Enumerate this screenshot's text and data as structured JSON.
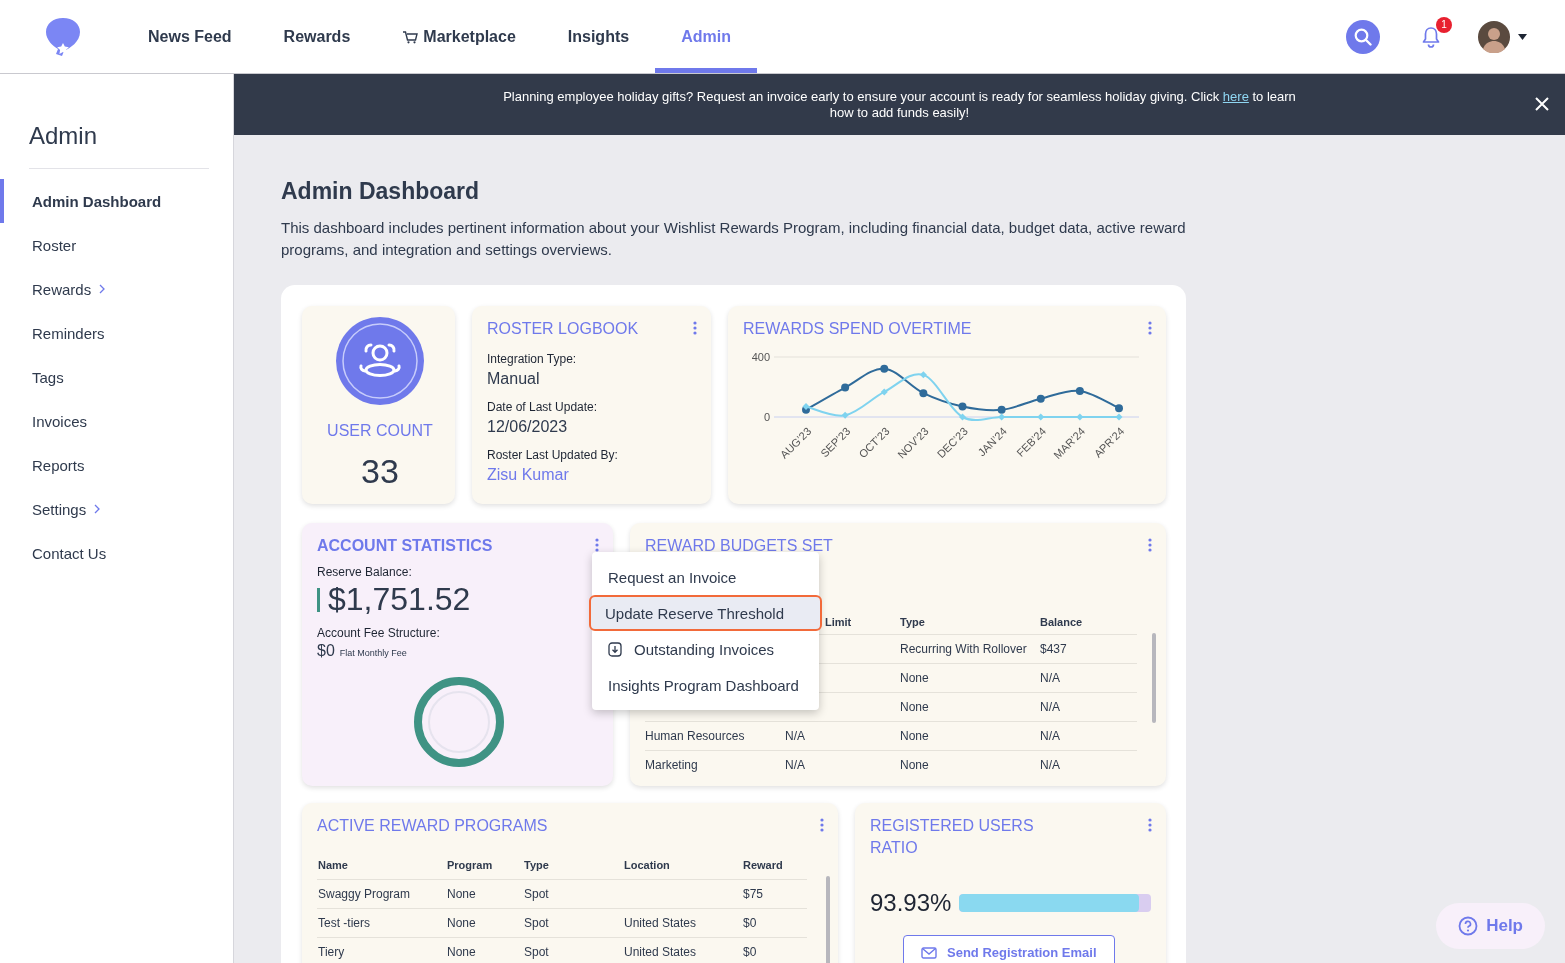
{
  "nav": {
    "tabs": [
      {
        "label": "News Feed",
        "selected": false,
        "kind": "plain"
      },
      {
        "label": "Rewards",
        "selected": false,
        "kind": "plain"
      },
      {
        "label": "Marketplace",
        "selected": false,
        "kind": "cart"
      },
      {
        "label": "Insights",
        "selected": false,
        "kind": "plain"
      },
      {
        "label": "Admin",
        "selected": true,
        "kind": "plain"
      }
    ],
    "notification_count": "1"
  },
  "banner": {
    "text_before": "Planning employee holiday gifts? Request an invoice early to ensure your account is ready for seamless holiday giving. Click",
    "link": "here",
    "text_after": "to learn how to add funds easily!"
  },
  "sidebar": {
    "title": "Admin",
    "items": [
      {
        "label": "Admin Dashboard",
        "selected": true,
        "has_submenu": false
      },
      {
        "label": "Roster",
        "selected": false,
        "has_submenu": false
      },
      {
        "label": "Rewards",
        "selected": false,
        "has_submenu": true
      },
      {
        "label": "Reminders",
        "selected": false,
        "has_submenu": false
      },
      {
        "label": "Tags",
        "selected": false,
        "has_submenu": false
      },
      {
        "label": "Invoices",
        "selected": false,
        "has_submenu": false
      },
      {
        "label": "Reports",
        "selected": false,
        "has_submenu": false
      },
      {
        "label": "Settings",
        "selected": false,
        "has_submenu": true
      },
      {
        "label": "Contact Us",
        "selected": false,
        "has_submenu": false
      }
    ]
  },
  "page": {
    "title": "Admin Dashboard",
    "description": "This dashboard includes pertinent information about your Wishlist Rewards Program, including financial data, budget data, active reward programs, and integration and settings overviews."
  },
  "user_count": {
    "label": "USER COUNT",
    "value": "33"
  },
  "roster_logbook": {
    "title": "ROSTER LOGBOOK",
    "fields": [
      {
        "label": "Integration Type:",
        "value": "Manual",
        "kind": "text"
      },
      {
        "label": "Date of Last Update:",
        "value": "12/06/2023",
        "kind": "text"
      },
      {
        "label": "Roster Last Updated By:",
        "value": "Zisu Kumar",
        "kind": "link"
      }
    ]
  },
  "rewards_spend": {
    "title": "REWARDS SPEND OVERTIME",
    "chart_data": {
      "type": "line",
      "categories": [
        "AUG’23",
        "SEP’23",
        "OCT’23",
        "NOV’23",
        "DEC’23",
        "JAN’24",
        "FEB’24",
        "MAR’24",
        "APR’24"
      ],
      "ylim": [
        0,
        400
      ],
      "yticks": [
        0,
        400
      ],
      "series": [
        {
          "color": "#2f6b9a",
          "marker": "circle",
          "values": [
            48,
            196,
            322,
            159,
            70,
            48,
            122,
            174,
            59
          ]
        },
        {
          "color": "#7fd3ef",
          "marker": "diamond",
          "values": [
            70,
            11,
            167,
            281,
            0,
            0,
            0,
            0,
            0
          ]
        }
      ]
    }
  },
  "account_statistics": {
    "title": "ACCOUNT STATISTICS",
    "reserve_label": "Reserve Balance:",
    "reserve_balance": "$1,751.52",
    "fee_label": "Account Fee Structure:",
    "fee_amount": "$0",
    "fee_note": "Flat Monthly Fee",
    "menu": [
      {
        "label": "Request an Invoice",
        "selected": false,
        "kind": "plain"
      },
      {
        "label": "Update Reserve Threshold",
        "selected": true,
        "kind": "plain"
      },
      {
        "label": "Outstanding Invoices",
        "selected": false,
        "kind": "download"
      },
      {
        "label": "Insights Program Dashboard",
        "selected": false,
        "kind": "plain"
      }
    ]
  },
  "reward_budgets": {
    "title": "REWARD BUDGETS SET",
    "columns": [
      "Limit",
      "Type",
      "Balance"
    ],
    "rows": [
      {
        "type": "Recurring With Rollover",
        "balance": "$437"
      },
      {
        "type": "None",
        "balance": "N/A"
      },
      {
        "type": "None",
        "balance": "N/A"
      },
      {
        "name": "Human Resources",
        "limit": "N/A",
        "type": "None",
        "balance": "N/A"
      },
      {
        "name": "Marketing",
        "limit": "N/A",
        "type": "None",
        "balance": "N/A"
      }
    ]
  },
  "active_programs": {
    "title": "ACTIVE REWARD PROGRAMS",
    "columns": [
      "Name",
      "Program",
      "Type",
      "Location",
      "Reward"
    ],
    "rows": [
      {
        "name": "Swaggy Program",
        "program": "None",
        "type": "Spot",
        "reward": "$75"
      },
      {
        "name": "Test -tiers",
        "program": "None",
        "type": "Spot",
        "location": "United States",
        "reward": "$0"
      },
      {
        "name": "Tiery",
        "program": "None",
        "type": "Spot",
        "location": "United States",
        "reward": "$0"
      }
    ]
  },
  "registered_users": {
    "title": "REGISTERED USERS RATIO",
    "percent": "93.93%",
    "level": 0.9393,
    "button": "Send Registration Email"
  },
  "help": {
    "label": "Help"
  }
}
